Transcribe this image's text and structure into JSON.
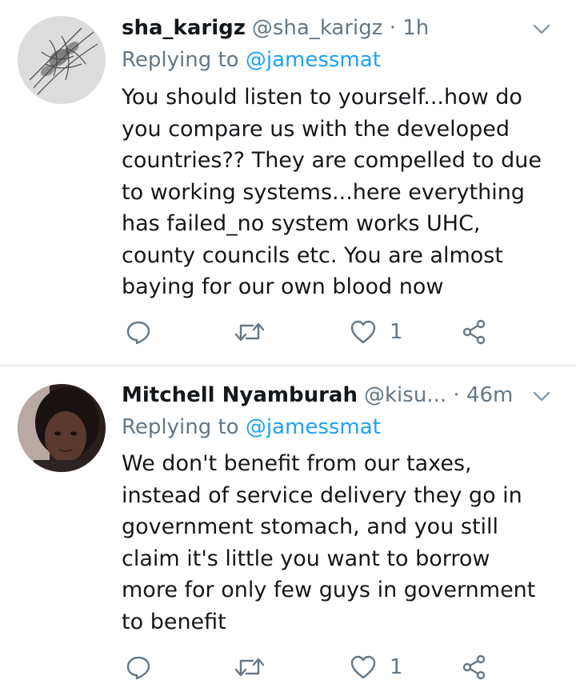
{
  "tweets": [
    {
      "display_name": "sha_karigz",
      "handle": "@sha_karigz",
      "separator": "·",
      "time": "1h",
      "replying_label": "Replying to",
      "replying_to": "@jamessmat",
      "text_lines": [
        "You should listen to yourself...how do",
        "you compare us with the developed",
        "countries?? They are compelled to due",
        "to working systems...here everything",
        "has failed_no system works UHC,",
        "county councils etc. You are almost",
        "baying for our own blood now"
      ],
      "like_count": "1"
    },
    {
      "display_name": "Mitchell Nyamburah",
      "handle": "@kisu...",
      "separator": "·",
      "time": "46m",
      "replying_label": "Replying to",
      "replying_to": "@jamessmat",
      "text_lines": [
        "We don't benefit from our taxes,",
        "instead of service delivery they go in",
        "government stomach, and you still",
        "claim it's little you want to borrow",
        "more for only few guys in government",
        "to benefit"
      ],
      "like_count": "1"
    }
  ],
  "icons": {
    "reply": "reply-icon",
    "retweet": "retweet-icon",
    "like": "heart-icon",
    "share": "share-icon",
    "menu": "chevron-down-icon"
  },
  "colors": {
    "text": "#14171a",
    "muted": "#657786",
    "link": "#1da1f2",
    "divider": "#e6ecf0"
  }
}
